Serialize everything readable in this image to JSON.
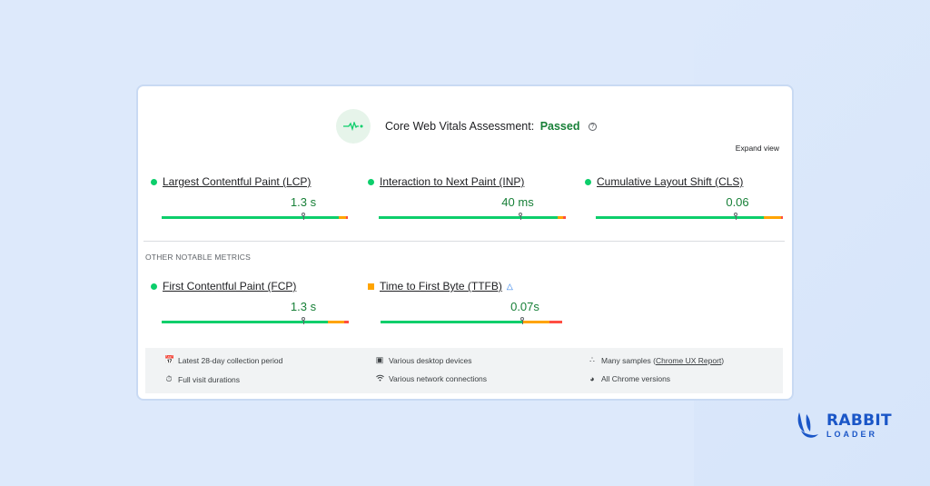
{
  "assessment": {
    "title": "Core Web Vitals Assessment:",
    "status": "Passed",
    "help_icon": "?",
    "expand_view": "Expand view"
  },
  "core_metrics": [
    {
      "name": "Largest Contentful Paint (LCP)",
      "value": "1.3 s",
      "status": "good"
    },
    {
      "name": "Interaction to Next Paint (INP)",
      "value": "40 ms",
      "status": "good"
    },
    {
      "name": "Cumulative Layout Shift (CLS)",
      "value": "0.06",
      "status": "good"
    }
  ],
  "other_heading": "OTHER NOTABLE METRICS",
  "other_metrics": [
    {
      "name": "First Contentful Paint (FCP)",
      "value": "1.3 s",
      "status": "good"
    },
    {
      "name": "Time to First Byte (TTFB)",
      "value": "0.07s",
      "status": "needs-improvement",
      "icon": "flask-icon"
    }
  ],
  "footer": {
    "period": "Latest 28-day collection period",
    "devices": "Various desktop devices",
    "samples_prefix": "Many samples (",
    "samples_link": "Chrome UX Report",
    "samples_suffix": ")",
    "durations": "Full visit durations",
    "connections": "Various network connections",
    "versions": "All Chrome versions"
  },
  "brand": {
    "line1": "RABBIT",
    "line2": "LOADER"
  },
  "colors": {
    "good": "#0cce6b",
    "needs_improvement": "#ffa400",
    "poor": "#ff4e42",
    "passed_text": "#188038",
    "background": "#dde9fb",
    "brand": "#1a56c7"
  }
}
